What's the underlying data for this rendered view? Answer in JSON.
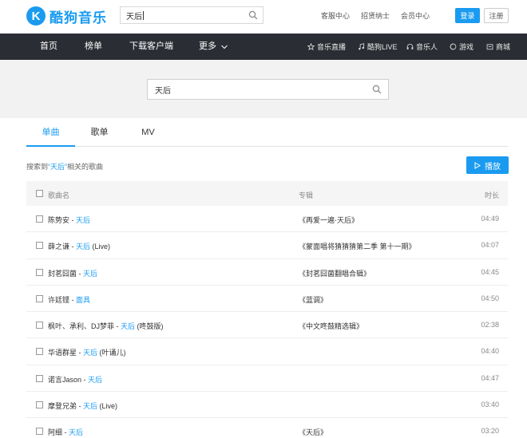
{
  "brand": {
    "logo_letter": "K",
    "name": "酷狗音乐",
    "color": "#1a9bf0"
  },
  "top_search": {
    "value": "天后"
  },
  "top_links": [
    "客服中心",
    "招贤纳士",
    "会员中心"
  ],
  "auth": {
    "login": "登录",
    "register": "注册"
  },
  "nav": {
    "items": [
      "首页",
      "榜单",
      "下载客户端",
      "更多"
    ],
    "right": [
      {
        "label": "音乐直播",
        "icon": "star-icon"
      },
      {
        "label": "酷狗LIVE",
        "icon": "music-note-icon"
      },
      {
        "label": "音乐人",
        "icon": "headphones-icon"
      },
      {
        "label": "游戏",
        "icon": "game-icon"
      },
      {
        "label": "商城",
        "icon": "shop-icon"
      }
    ]
  },
  "main_search": {
    "value": "天后"
  },
  "tabs": [
    "单曲",
    "歌单",
    "MV"
  ],
  "summary": {
    "prefix": "搜索到",
    "keyword": "“天后”",
    "suffix": "相关的歌曲"
  },
  "play_button": "播放",
  "table": {
    "headers": {
      "name": "歌曲名",
      "album": "专辑",
      "duration": "时长"
    },
    "rows": [
      {
        "artist": "陈势安",
        "sep": " - ",
        "title": "天后",
        "extra": "",
        "album": "《再爱一遍·天后》",
        "duration": "04:49"
      },
      {
        "artist": "薛之谦",
        "sep": " - ",
        "title": "天后",
        "extra": " (Live)",
        "album": "《蒙面唱将猜猜猜第二季 第十一期》",
        "duration": "04:07"
      },
      {
        "artist": "封茗囧菌",
        "sep": " - ",
        "title": "天后",
        "extra": "",
        "album": "《封茗囧菌翻唱合辑》",
        "duration": "04:45"
      },
      {
        "artist": "许廷铿",
        "sep": " - ",
        "title": "面具",
        "extra": "",
        "album": "《蓝调》",
        "duration": "04:50"
      },
      {
        "artist": "枫叶、承利、DJ梦菲",
        "sep": " - ",
        "title": "天后",
        "extra": " (咚鼓版)",
        "album": "《中文咚鼓精选辑》",
        "duration": "02:38"
      },
      {
        "artist": "华语群星",
        "sep": " - ",
        "title": "天后",
        "extra": " (叶诵儿)",
        "album": "",
        "duration": "04:40"
      },
      {
        "artist": "诺言Jason",
        "sep": " - ",
        "title": "天后",
        "extra": "",
        "album": "",
        "duration": "04:47"
      },
      {
        "artist": "摩登兄弟",
        "sep": " - ",
        "title": "天后",
        "extra": " (Live)",
        "album": "",
        "duration": "03:40"
      },
      {
        "artist": "阿细",
        "sep": " - ",
        "title": "天后",
        "extra": "",
        "album": "《天后》",
        "duration": "03:20"
      }
    ]
  }
}
